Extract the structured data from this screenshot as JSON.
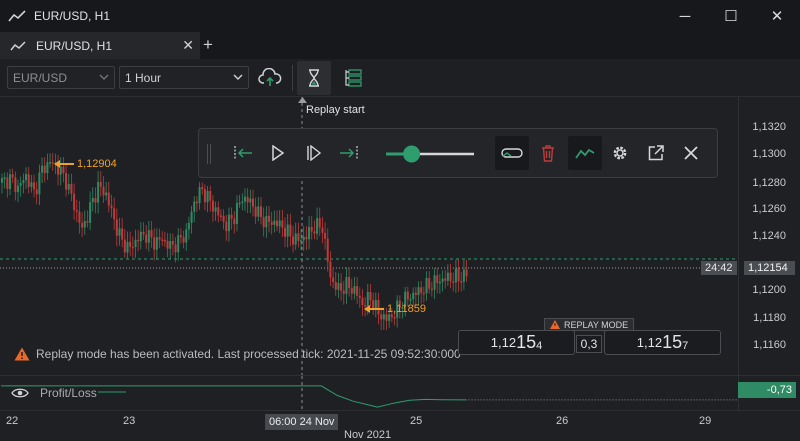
{
  "window": {
    "title": "EUR/USD, H1",
    "minimize_glyph": "─",
    "maximize_glyph": "☐",
    "close_glyph": "✕"
  },
  "tabs": [
    {
      "label": "EUR/USD, H1",
      "close_glyph": "✕"
    }
  ],
  "add_tab_glyph": "+",
  "toolbar": {
    "symbol_select": {
      "value": "EUR/USD"
    },
    "timeframe_select": {
      "value": "1 Hour"
    },
    "buttons": [
      "cloud-upload-icon",
      "hourglass-icon",
      "layers-icon"
    ]
  },
  "replay": {
    "tooltip": "Replay start",
    "controls": [
      "step-to-start-icon",
      "play-icon",
      "step-forward-icon",
      "step-to-end-icon",
      "speed-slider",
      "loop-icon",
      "trash-icon",
      "chart-line-icon",
      "gear-icon",
      "external-link-icon",
      "close-icon"
    ],
    "speed_level": 0.2,
    "status_message": "Replay mode has been activated. Last processed tick: 2021-11-25 09:52:30:000",
    "mode_badge": "REPLAY MODE",
    "bid": {
      "prefix": "1,12",
      "big": "15",
      "small": "4"
    },
    "ask": {
      "prefix": "1,12",
      "big": "15",
      "small": "7"
    },
    "spread": "0,3"
  },
  "annotations": {
    "high_label": "1,12904",
    "low_label": "1,11859"
  },
  "price_axis": {
    "ticks": [
      "1,1320",
      "1,1300",
      "1,1280",
      "1,1260",
      "1,1240",
      "1,1200",
      "1,1180",
      "1,1160"
    ],
    "current_price": "1,12154",
    "countdown": "24:42"
  },
  "pl_pane": {
    "label": "Profit/Loss",
    "value": "-0,73"
  },
  "time_axis": {
    "ticks": [
      "22",
      "23",
      "25",
      "26",
      "29"
    ],
    "cursor_label": "06:00 24 Nov",
    "month_label": "Nov 2021"
  },
  "colors": {
    "bull": "#2e8b63",
    "bear": "#c23a3a",
    "accent": "#2e9e6e",
    "annotation": "#f0a02d",
    "warning": "#e8692a"
  },
  "chart_data": {
    "type": "candlestick",
    "series_name": "EUR/USD",
    "timeframe": "1 Hour",
    "x_range": [
      "2021-11-22",
      "2021-11-29"
    ],
    "y_range": [
      1.115,
      1.133
    ],
    "annotated_high": 1.12904,
    "annotated_low": 1.11859,
    "last_price": 1.12154,
    "close_path": [
      [
        0,
        1.1275
      ],
      [
        3,
        1.1277
      ],
      [
        6,
        1.1271
      ],
      [
        9,
        1.1279
      ],
      [
        12,
        1.1268
      ],
      [
        15,
        1.1283
      ],
      [
        18,
        1.1288
      ],
      [
        21,
        1.1284
      ],
      [
        24,
        1.1276
      ],
      [
        27,
        1.126
      ],
      [
        30,
        1.1244
      ],
      [
        33,
        1.1258
      ],
      [
        36,
        1.1272
      ],
      [
        39,
        1.1267
      ],
      [
        42,
        1.125
      ],
      [
        45,
        1.1236
      ],
      [
        48,
        1.1232
      ],
      [
        51,
        1.1239
      ],
      [
        54,
        1.1241
      ],
      [
        57,
        1.1236
      ],
      [
        60,
        1.1238
      ],
      [
        63,
        1.1233
      ],
      [
        66,
        1.1236
      ],
      [
        69,
        1.1242
      ],
      [
        72,
        1.1262
      ],
      [
        75,
        1.127
      ],
      [
        78,
        1.1262
      ],
      [
        81,
        1.1254
      ],
      [
        84,
        1.1247
      ],
      [
        87,
        1.1253
      ],
      [
        90,
        1.1265
      ],
      [
        93,
        1.1262
      ],
      [
        96,
        1.1254
      ],
      [
        99,
        1.1249
      ],
      [
        102,
        1.1249
      ],
      [
        105,
        1.1246
      ],
      [
        108,
        1.124
      ],
      [
        111,
        1.1237
      ],
      [
        114,
        1.124
      ],
      [
        117,
        1.1246
      ],
      [
        120,
        1.1246
      ],
      [
        123,
        1.1213
      ],
      [
        126,
        1.1205
      ],
      [
        129,
        1.1208
      ],
      [
        132,
        1.1205
      ],
      [
        135,
        1.1196
      ],
      [
        138,
        1.12
      ],
      [
        141,
        1.119
      ],
      [
        144,
        1.1186
      ],
      [
        147,
        1.119
      ],
      [
        150,
        1.1198
      ],
      [
        153,
        1.1201
      ],
      [
        156,
        1.1204
      ],
      [
        159,
        1.1207
      ],
      [
        162,
        1.121
      ],
      [
        165,
        1.1212
      ],
      [
        168,
        1.1213
      ],
      [
        171,
        1.1213
      ],
      [
        174,
        1.1215
      ]
    ],
    "profit_loss": [
      [
        0,
        0
      ],
      [
        120,
        0
      ],
      [
        126,
        -0.5
      ],
      [
        132,
        -0.8
      ],
      [
        138,
        -1.0
      ],
      [
        141,
        -1.1
      ],
      [
        147,
        -0.9
      ],
      [
        153,
        -0.75
      ],
      [
        159,
        -0.7
      ],
      [
        165,
        -0.72
      ],
      [
        174,
        -0.73
      ]
    ]
  }
}
